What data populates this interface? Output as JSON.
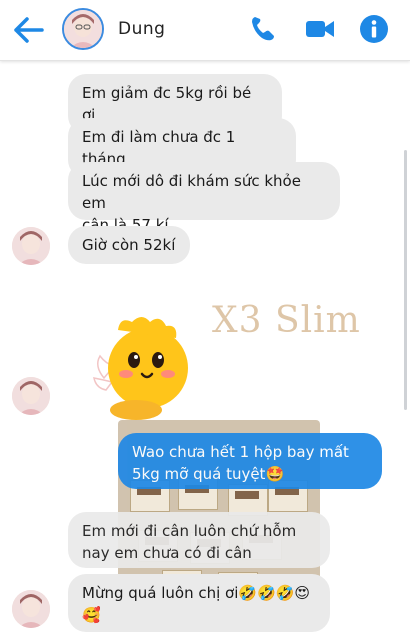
{
  "header": {
    "contact_name": "Dung",
    "accent": "#1e88e5"
  },
  "messages": [
    {
      "side": "incoming",
      "text": "Em giảm đc 5kg rồi bé ơi"
    },
    {
      "side": "incoming",
      "text": "Em đi làm chưa đc 1 tháng"
    },
    {
      "side": "incoming",
      "line1": "Lúc mới dô đi khám sức khỏe em",
      "line2": "cân là 57 kí"
    },
    {
      "side": "incoming",
      "text": "Giờ còn 52kí"
    },
    {
      "side": "outgoing",
      "line1": "Wao chưa hết 1 hộp bay mất",
      "line2": "5kg mỡ quá tuyệt🤩"
    },
    {
      "side": "incoming",
      "line1": "Em mới đi cân luôn chứ hỗm",
      "line2": "nay em chưa có đi cân"
    },
    {
      "side": "incoming",
      "line1": "Mừng quá luôn chị ơi🤣🤣🤣😍",
      "line2": "🥰"
    }
  ],
  "watermark": "X3 Slim",
  "sticker": "sticker-yellow-creature"
}
